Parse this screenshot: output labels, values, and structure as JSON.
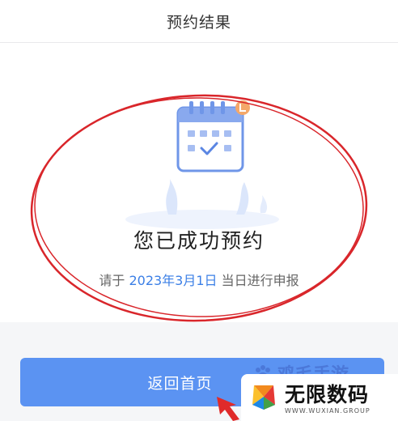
{
  "header": {
    "title": "预约结果"
  },
  "result": {
    "title": "您已成功预约",
    "subtitle_prefix": "请于 ",
    "date": "2023年3月1日",
    "subtitle_suffix": " 当日进行申报"
  },
  "home_button": {
    "label": "返回首页"
  },
  "watermark": {
    "partial_text": "鸡毛手游",
    "name": "无限数码",
    "url": "WWW.WUXIAN.GROUP"
  },
  "colors": {
    "accent": "#3b7fe6",
    "button": "#5b93f2",
    "annotation_red": "#d9262b",
    "badge": "#f4a86a"
  },
  "icons": [
    "calendar-icon",
    "calendar-badge",
    "paw-icon",
    "wuxian-logo-icon",
    "pointer-arrow-icon"
  ]
}
